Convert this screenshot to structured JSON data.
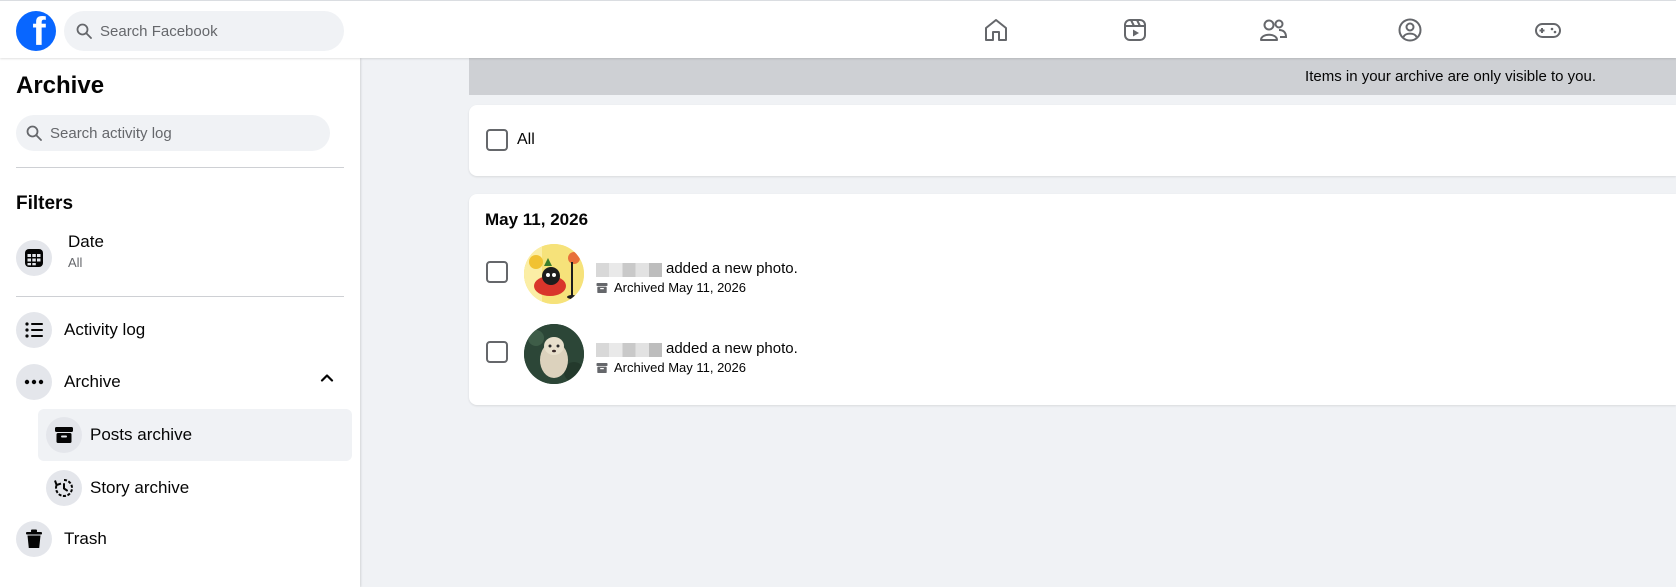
{
  "topbar": {
    "logo_letter": "f",
    "search_placeholder": "Search Facebook",
    "nav": [
      "home-icon",
      "video-icon",
      "friends-icon",
      "groups-icon",
      "gaming-icon"
    ]
  },
  "sidebar": {
    "title": "Archive",
    "search_placeholder": "Search activity log",
    "filters_title": "Filters",
    "date_filter": {
      "label": "Date",
      "value": "All"
    },
    "items": [
      {
        "label": "Activity log",
        "icon": "list-icon"
      },
      {
        "label": "Archive",
        "icon": "more-icon",
        "expanded": true
      },
      {
        "label": "Posts archive",
        "icon": "archive-box-icon",
        "active": true
      },
      {
        "label": "Story archive",
        "icon": "story-history-icon"
      },
      {
        "label": "Trash",
        "icon": "trash-icon"
      }
    ]
  },
  "main": {
    "banner_text": "Items in your archive are only visible to you.",
    "select_all_label": "All",
    "date_heading": "May 11, 2026",
    "posts": [
      {
        "action": "added a new photo.",
        "archived": "Archived May 11, 2026"
      },
      {
        "action": "added a new photo.",
        "archived": "Archived May 11, 2026"
      }
    ]
  },
  "colors": {
    "brand": "#0866ff",
    "banner": "#ced0d4",
    "background": "#f0f2f5"
  }
}
